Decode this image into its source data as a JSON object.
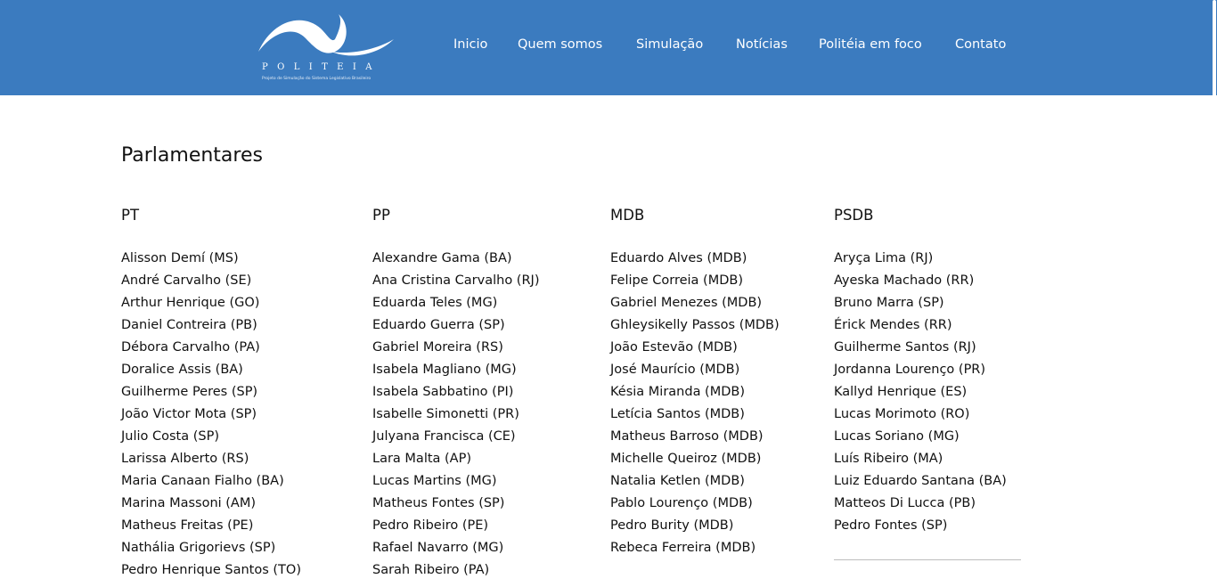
{
  "header": {
    "logo": {
      "wordmark": "POLITEIA",
      "tagline": "Projeto de Simulação do Sistema Legislativo Brasileiro"
    },
    "nav": [
      {
        "label": "Inicio",
        "name": "nav-inicio"
      },
      {
        "label": "Quem somos",
        "name": "nav-quem-somos"
      },
      {
        "label": "Simulação",
        "name": "nav-simulacao"
      },
      {
        "label": "Notícias",
        "name": "nav-noticias"
      },
      {
        "label": "Politéia em foco",
        "name": "nav-politeia-em-foco"
      },
      {
        "label": "Contato",
        "name": "nav-contato"
      }
    ]
  },
  "page": {
    "title": "Parlamentares"
  },
  "parties": [
    {
      "name": "PT",
      "members": [
        "Alisson Demí (MS)",
        "André Carvalho (SE)",
        "Arthur Henrique (GO)",
        "Daniel Contreira (PB)",
        "Débora Carvalho (PA)",
        "Doralice Assis (BA)",
        "Guilherme Peres (SP)",
        "João Victor Mota (SP)",
        "Julio Costa (SP)",
        "Larissa Alberto (RS)",
        "Maria Canaan Fialho (BA)",
        "Marina Massoni (AM)",
        "Matheus Freitas (PE)",
        "Nathália Grigorievs (SP)",
        "Pedro Henrique Santos (TO)"
      ]
    },
    {
      "name": "PP",
      "members": [
        "Alexandre Gama (BA)",
        "Ana Cristina Carvalho (RJ)",
        "Eduarda Teles (MG)",
        "Eduardo Guerra (SP)",
        "Gabriel Moreira (RS)",
        "Isabela Magliano (MG)",
        "Isabela Sabbatino (PI)",
        "Isabelle Simonetti (PR)",
        "Julyana Francisca (CE)",
        "Lara Malta (AP)",
        "Lucas Martins (MG)",
        "Matheus Fontes (SP)",
        "Pedro Ribeiro (PE)",
        "Rafael Navarro (MG)",
        "Sarah Ribeiro (PA)"
      ]
    },
    {
      "name": "MDB",
      "members": [
        "Eduardo Alves (MDB)",
        "Felipe Correia (MDB)",
        "Gabriel Menezes (MDB)",
        "Ghleysikelly Passos (MDB)",
        "João Estevão (MDB)",
        "José Maurício (MDB)",
        "Késia Miranda (MDB)",
        "Letícia Santos (MDB)",
        "Matheus Barroso (MDB)",
        "Michelle Queiroz (MDB)",
        "Natalia Ketlen (MDB)",
        "Pablo Lourenço (MDB)",
        "Pedro Burity (MDB)",
        "Rebeca Ferreira (MDB)"
      ]
    },
    {
      "name": "PSDB",
      "members": [
        "Aryça Lima (RJ)",
        "Ayeska Machado (RR)",
        "Bruno Marra (SP)",
        "Érick Mendes (RR)",
        "Guilherme Santos (RJ)",
        "Jordanna Lourenço (PR)",
        "Kallyd Henrique (ES)",
        "Lucas Morimoto (RO)",
        "Lucas Soriano (MG)",
        "Luís Ribeiro (MA)",
        "Luiz Eduardo Santana (BA)",
        "Matteos Di Lucca (PB)",
        "Pedro Fontes (SP)"
      ]
    }
  ],
  "colors": {
    "header_bg": "#3b7bbf",
    "nav_text": "#ffffff",
    "body_text": "#111111"
  }
}
